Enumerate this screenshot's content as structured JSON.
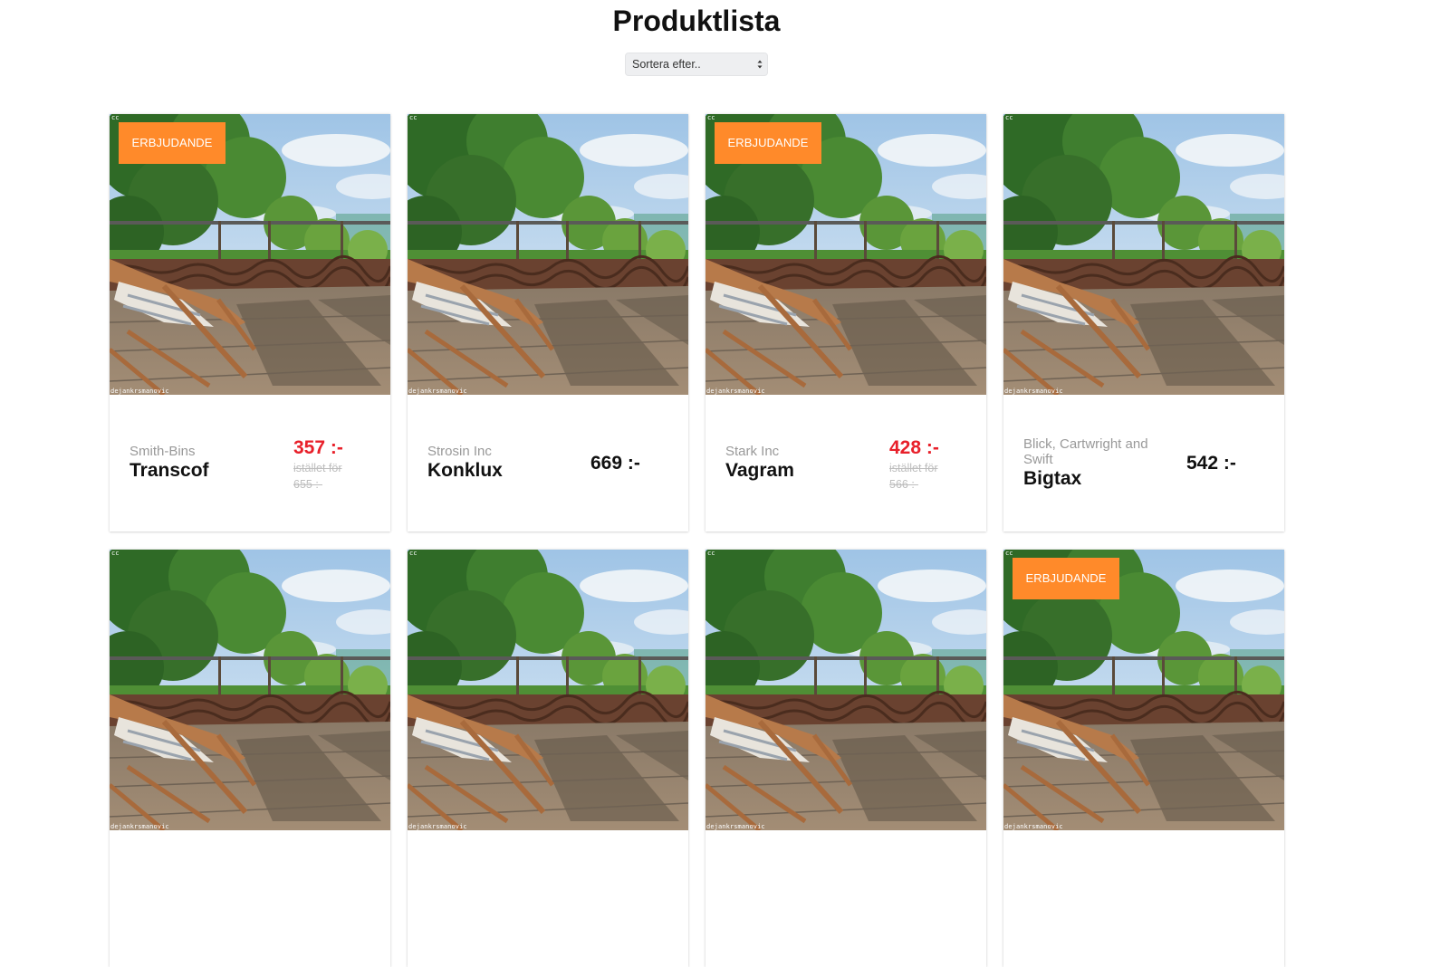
{
  "page": {
    "title": "Produktlista"
  },
  "sort": {
    "placeholder": "Sortera efter.."
  },
  "image": {
    "cc_mark": "cc",
    "credit": "dejankrsmanovic"
  },
  "badge_label": "ERBJUDANDE",
  "products": [
    {
      "company": "Smith-Bins",
      "name": "Transcof",
      "price": "357 :-",
      "on_sale": true,
      "original_price": "istället för 655 :-"
    },
    {
      "company": "Strosin Inc",
      "name": "Konklux",
      "price": "669 :-",
      "on_sale": false,
      "original_price": ""
    },
    {
      "company": "Stark Inc",
      "name": "Vagram",
      "price": "428 :-",
      "on_sale": true,
      "original_price": "istället för 566 :-"
    },
    {
      "company": "Blick, Cartwright and Swift",
      "name": "Bigtax",
      "price": "542 :-",
      "on_sale": false,
      "original_price": ""
    },
    {
      "company": "",
      "name": "",
      "price": "",
      "on_sale": false,
      "original_price": ""
    },
    {
      "company": "",
      "name": "",
      "price": "",
      "on_sale": false,
      "original_price": ""
    },
    {
      "company": "",
      "name": "",
      "price": "",
      "on_sale": false,
      "original_price": ""
    },
    {
      "company": "",
      "name": "",
      "price": "",
      "on_sale": true,
      "original_price": ""
    }
  ],
  "colors": {
    "badge": "#ff8a2a",
    "sale_price": "#e8202a",
    "muted_text": "#999999",
    "struck_price": "#bdbdbd"
  }
}
